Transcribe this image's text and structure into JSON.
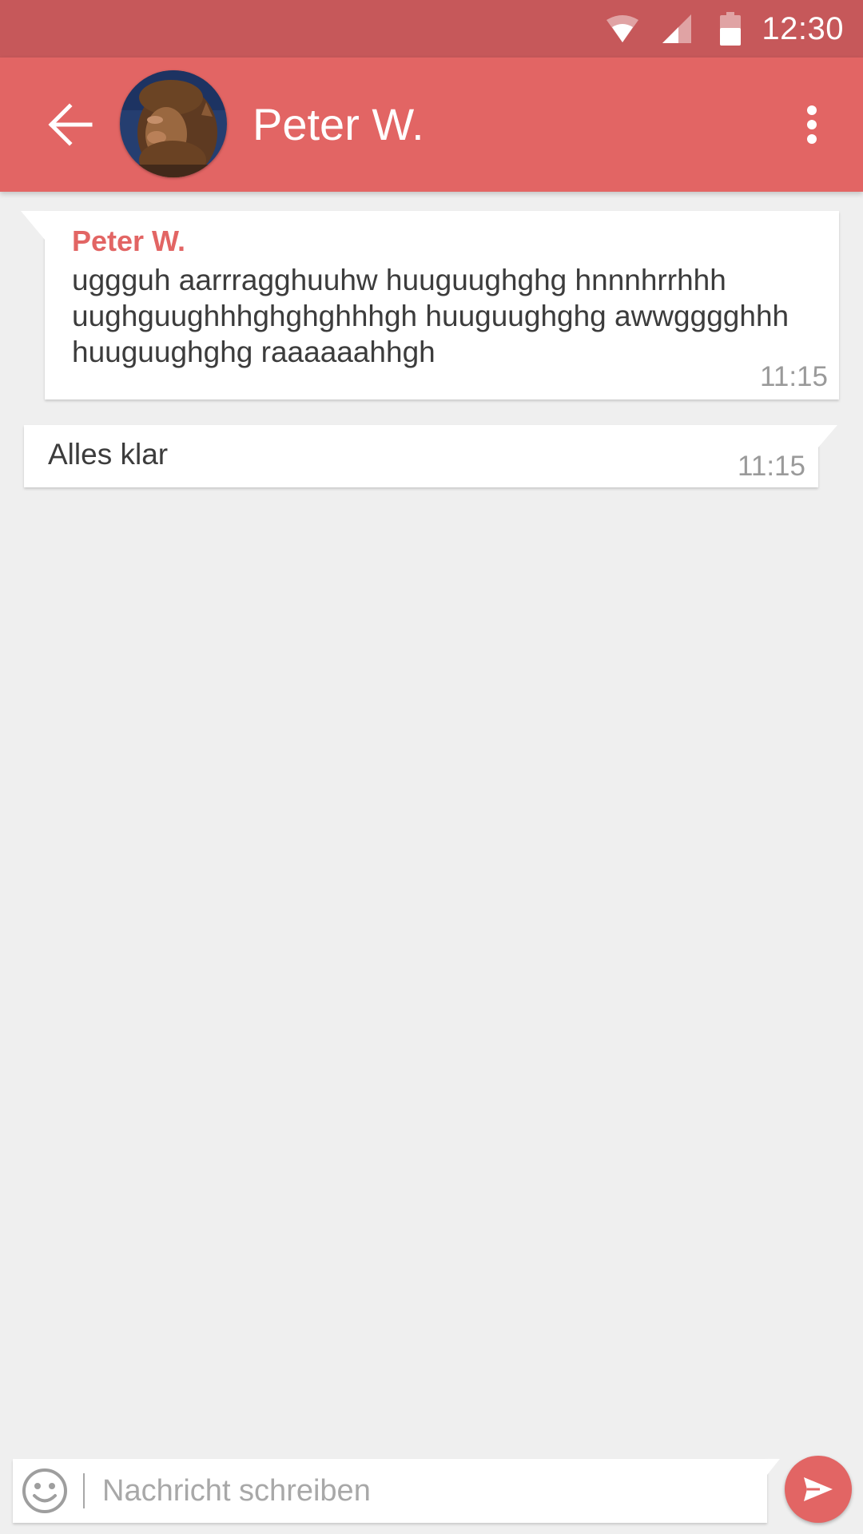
{
  "colors": {
    "status_bar": "#c6585a",
    "app_bar": "#e26564",
    "accent": "#e26564",
    "background": "#efefef",
    "bubble": "#ffffff",
    "timestamp": "#9a9a9a"
  },
  "status_bar": {
    "time": "12:30",
    "icons": [
      "wifi-icon",
      "cell-signal-icon",
      "battery-icon"
    ]
  },
  "header": {
    "back_icon": "arrow-left-icon",
    "avatar_icon": "contact-avatar",
    "title": "Peter W.",
    "menu_icon": "more-vertical-icon"
  },
  "messages": [
    {
      "direction": "incoming",
      "sender": "Peter W.",
      "text": "uggguh aarrragghuuhw huuguughghg hnnnhrrhhh uughguughhhghghghhhgh huuguughghg awwgggghhh huuguughghg raaaaaahhgh",
      "time": "11:15"
    },
    {
      "direction": "outgoing",
      "text": "Alles klar",
      "time": "11:15"
    }
  ],
  "composer": {
    "emoji_icon": "smiley-icon",
    "placeholder": "Nachricht schreiben",
    "value": "",
    "send_icon": "send-icon"
  }
}
